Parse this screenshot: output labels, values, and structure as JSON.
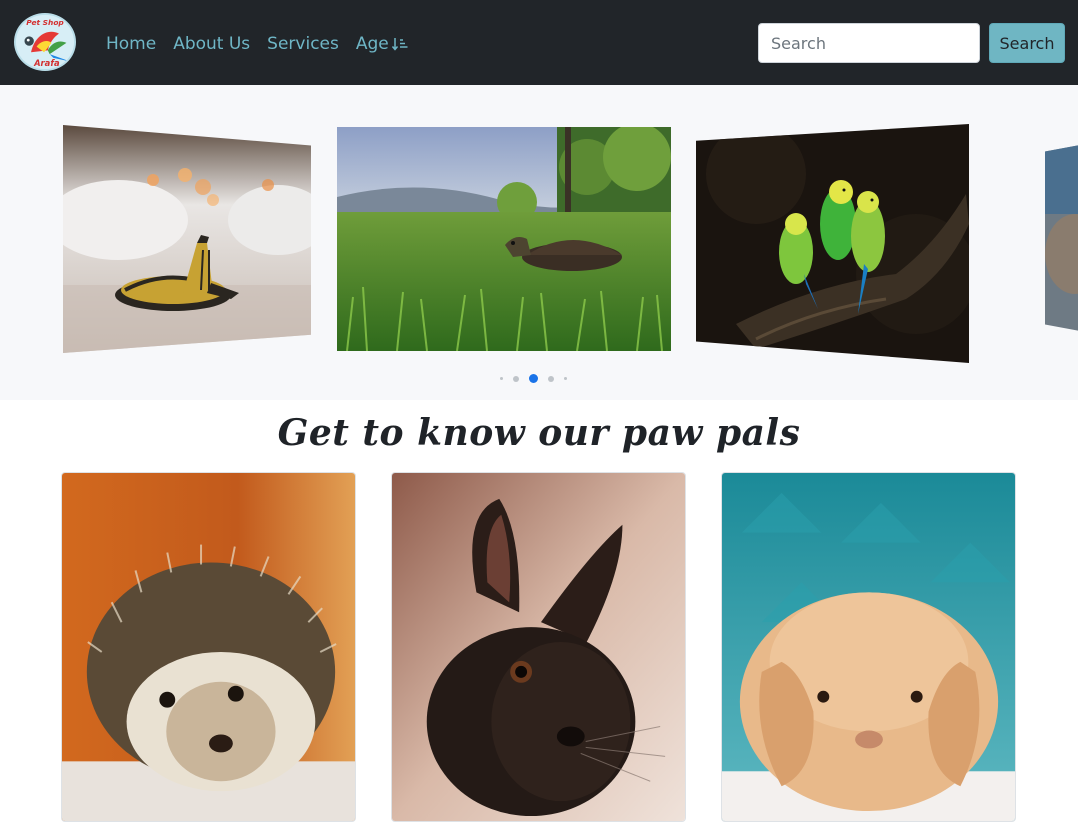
{
  "navbar": {
    "logo_text_top": "Pet Shop",
    "logo_text_bottom": "Arafa",
    "links": [
      {
        "label": "Home"
      },
      {
        "label": "About Us"
      },
      {
        "label": "Services"
      },
      {
        "label": "Age"
      }
    ],
    "sort_icon": "sort-down-icon",
    "search": {
      "placeholder": "Search",
      "value": "",
      "button_label": "Search"
    },
    "colors": {
      "background": "#212529",
      "link": "#6fb6c6",
      "button": "#6fb6c3"
    }
  },
  "carousel": {
    "slides": [
      {
        "subject": "turtle on wooden surface"
      },
      {
        "subject": "turtle in grass"
      },
      {
        "subject": "two budgerigars on branch"
      },
      {
        "subject": "partial next slide"
      }
    ],
    "indicators": 5,
    "active_index": 2,
    "colors": {
      "active_dot": "#1a73e8",
      "dot": "#bfc4c9"
    }
  },
  "section": {
    "title": "Get to know our paw pals"
  },
  "cards": [
    {
      "subject": "hedgehog"
    },
    {
      "subject": "black rabbit"
    },
    {
      "subject": "orange lop rabbit"
    }
  ]
}
